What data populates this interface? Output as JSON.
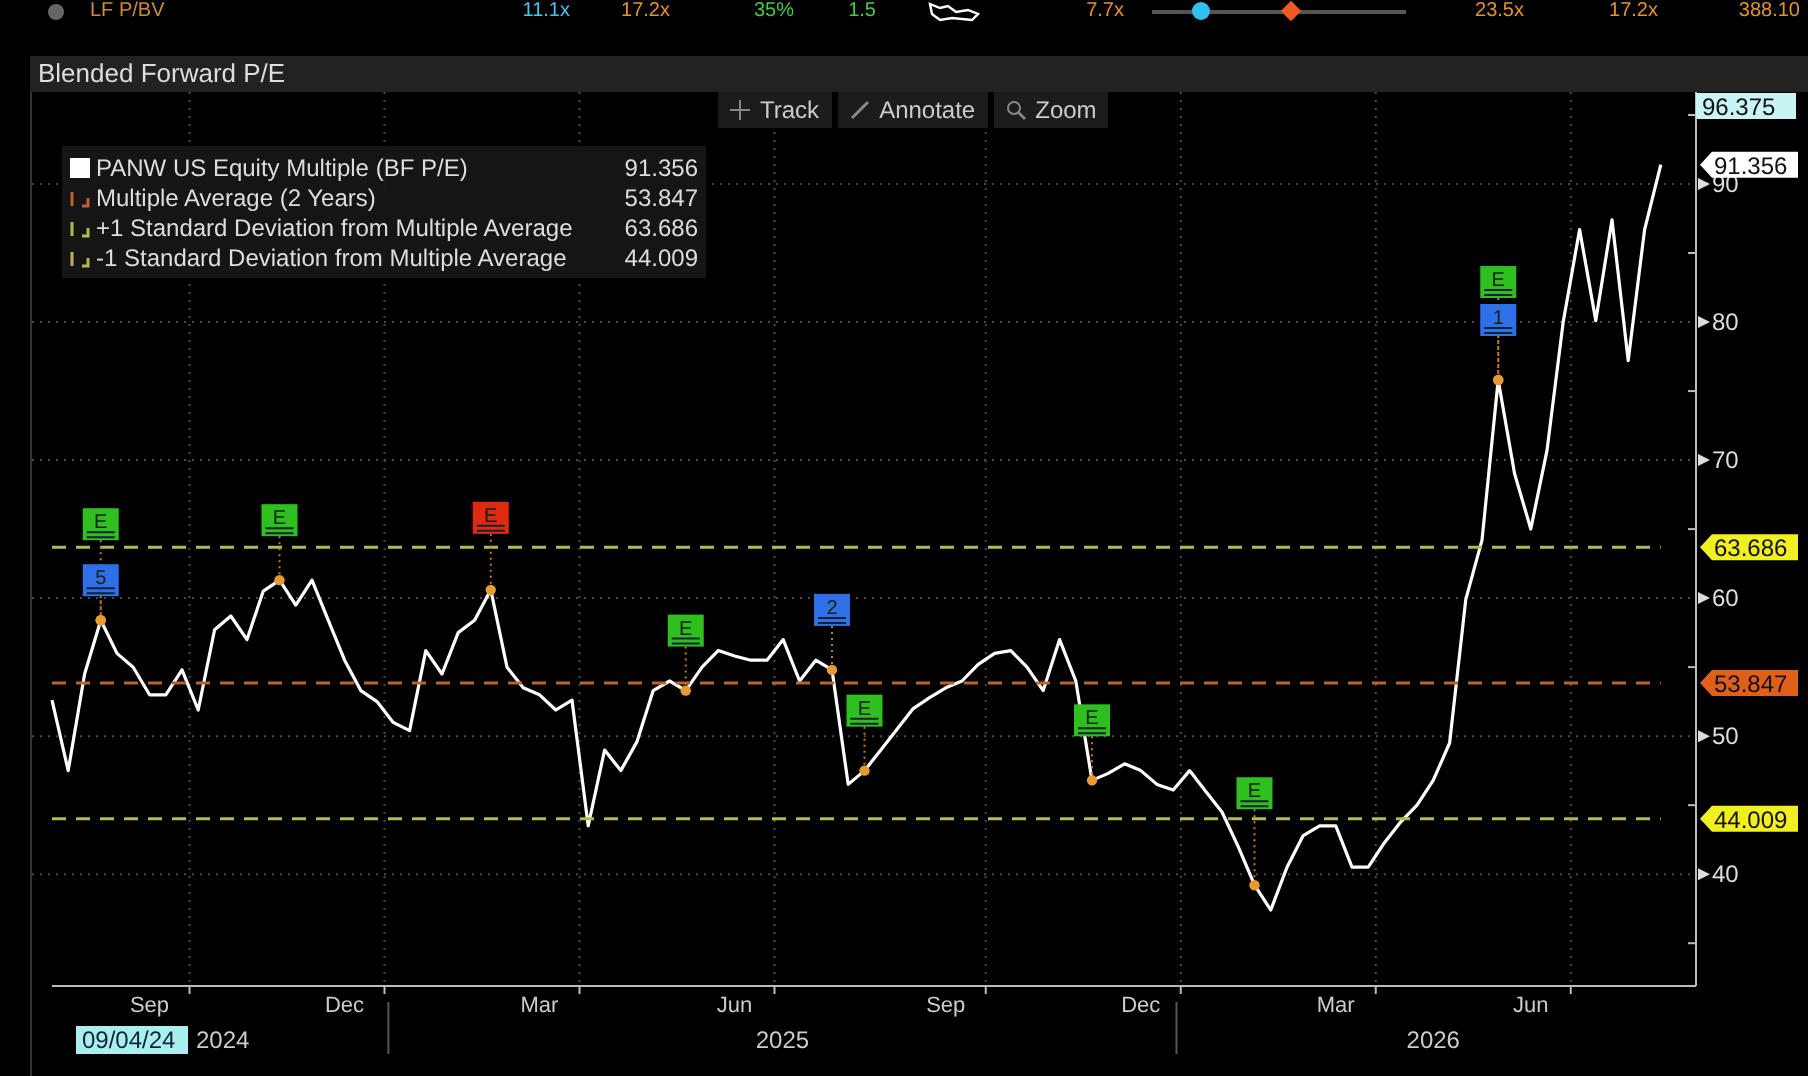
{
  "ticker_strip": {
    "label": {
      "text": "LF P/BV",
      "color": "#d08a30"
    },
    "values": [
      {
        "text": "11.1x",
        "color": "#40c8f0"
      },
      {
        "text": "17.2x",
        "color": "#e8902a"
      },
      {
        "text": "35%",
        "color": "#40d040"
      },
      {
        "text": "1.5",
        "color": "#40d040"
      },
      {
        "text": "7.7x",
        "color": "#e8902a"
      },
      {
        "text": "23.5x",
        "color": "#e8902a"
      },
      {
        "text": "17.2x",
        "color": "#e8902a"
      },
      {
        "text": "388.10",
        "color": "#e8902a"
      }
    ],
    "range_markers": [
      {
        "level": 0.19,
        "color": "#30c0f0"
      },
      {
        "level": 0.54,
        "color": "#f05a20"
      }
    ]
  },
  "panel": {
    "title": "Blended Forward P/E",
    "toolbar": [
      {
        "label": "Track",
        "kind": "crosshair"
      },
      {
        "label": "Annotate",
        "kind": "pencil"
      },
      {
        "label": "Zoom",
        "kind": "search"
      }
    ],
    "legend_values": [
      "91.356",
      "53.847",
      "63.686",
      "44.009"
    ],
    "chart_data": {
      "type": "line",
      "grid": true,
      "legend": "upper left",
      "categories": [
        null,
        null,
        null,
        null,
        null,
        null,
        "Sep",
        null,
        null,
        null,
        null,
        null,
        null,
        null,
        null,
        null,
        null,
        null,
        "Dec",
        null,
        null,
        null,
        null,
        null,
        null,
        null,
        null,
        null,
        null,
        null,
        "Mar",
        null,
        null,
        null,
        null,
        null,
        null,
        null,
        null,
        null,
        null,
        null,
        "Jun",
        null,
        null,
        null,
        null,
        null,
        null,
        null,
        null,
        null,
        null,
        null,
        null,
        "Sep",
        null,
        null,
        null,
        null,
        null,
        null,
        null,
        null,
        null,
        null,
        null,
        "Dec",
        null,
        null,
        null,
        null,
        null,
        null,
        null,
        null,
        null,
        null,
        null,
        "Mar",
        null,
        null,
        null,
        null,
        null,
        null,
        null,
        null,
        null,
        null,
        null,
        "Jun",
        null,
        null,
        null,
        null,
        null,
        null,
        null,
        null
      ],
      "series": [
        {
          "name": "PANW US Equity Multiple (BF P/E)",
          "color": "#ffffff",
          "values": [
            52.6,
            47.5,
            54.5,
            58.4,
            56,
            55,
            53,
            53,
            54.8,
            51.9,
            57.7,
            58.7,
            57,
            60.5,
            61.3,
            59.5,
            61.3,
            58.4,
            55.5,
            53.3,
            52.5,
            51,
            50.4,
            56.2,
            54.5,
            57.5,
            58.4,
            60.6,
            55,
            53.5,
            53,
            51.9,
            52.6,
            43.5,
            49,
            47.5,
            49.6,
            53.3,
            54,
            53.3,
            55,
            56.2,
            55.8,
            55.5,
            55.5,
            57,
            54,
            55.5,
            54.8,
            46.5,
            47.5,
            49,
            50.5,
            52,
            52.8,
            53.5,
            54,
            55.2,
            56,
            56.2,
            55,
            53.3,
            57,
            54,
            46.8,
            47.3,
            48,
            47.5,
            46.5,
            46.1,
            47.5,
            46,
            44.5,
            42,
            39.2,
            37.4,
            40.5,
            42.8,
            43.5,
            43.5,
            40.5,
            40.5,
            42.3,
            43.8,
            45,
            46.8,
            49.5,
            59.9,
            64.2,
            75.8,
            69,
            65,
            70.7,
            80,
            86.7,
            80.1,
            87.4,
            77.2,
            86.7,
            91.4
          ]
        },
        {
          "name": "Multiple Average (2 Years)",
          "color": "#c0602a",
          "line_style": "dashed",
          "values": [
            53.847,
            53.847,
            53.847,
            53.847,
            53.847,
            53.847,
            53.847,
            53.847,
            53.847,
            53.847,
            53.847,
            53.847,
            53.847,
            53.847,
            53.847,
            53.847,
            53.847,
            53.847,
            53.847,
            53.847,
            53.847,
            53.847,
            53.847,
            53.847,
            53.847,
            53.847,
            53.847,
            53.847,
            53.847,
            53.847,
            53.847,
            53.847,
            53.847,
            53.847,
            53.847,
            53.847,
            53.847,
            53.847,
            53.847,
            53.847,
            53.847,
            53.847,
            53.847,
            53.847,
            53.847,
            53.847,
            53.847,
            53.847,
            53.847,
            53.847,
            53.847,
            53.847,
            53.847,
            53.847,
            53.847,
            53.847,
            53.847,
            53.847,
            53.847,
            53.847,
            53.847,
            53.847,
            53.847,
            53.847,
            53.847,
            53.847,
            53.847,
            53.847,
            53.847,
            53.847,
            53.847,
            53.847,
            53.847,
            53.847,
            53.847,
            53.847,
            53.847,
            53.847,
            53.847,
            53.847,
            53.847,
            53.847,
            53.847,
            53.847,
            53.847,
            53.847,
            53.847,
            53.847,
            53.847,
            53.847,
            53.847,
            53.847,
            53.847,
            53.847,
            53.847,
            53.847,
            53.847,
            53.847,
            53.847,
            53.847
          ]
        },
        {
          "name": "+1 Standard Deviation from Multiple Average",
          "color": "#b8b850",
          "line_style": "dashed",
          "values": [
            63.686,
            63.686,
            63.686,
            63.686,
            63.686,
            63.686,
            63.686,
            63.686,
            63.686,
            63.686,
            63.686,
            63.686,
            63.686,
            63.686,
            63.686,
            63.686,
            63.686,
            63.686,
            63.686,
            63.686,
            63.686,
            63.686,
            63.686,
            63.686,
            63.686,
            63.686,
            63.686,
            63.686,
            63.686,
            63.686,
            63.686,
            63.686,
            63.686,
            63.686,
            63.686,
            63.686,
            63.686,
            63.686,
            63.686,
            63.686,
            63.686,
            63.686,
            63.686,
            63.686,
            63.686,
            63.686,
            63.686,
            63.686,
            63.686,
            63.686,
            63.686,
            63.686,
            63.686,
            63.686,
            63.686,
            63.686,
            63.686,
            63.686,
            63.686,
            63.686,
            63.686,
            63.686,
            63.686,
            63.686,
            63.686,
            63.686,
            63.686,
            63.686,
            63.686,
            63.686,
            63.686,
            63.686,
            63.686,
            63.686,
            63.686,
            63.686,
            63.686,
            63.686,
            63.686,
            63.686,
            63.686,
            63.686,
            63.686,
            63.686,
            63.686,
            63.686,
            63.686,
            63.686,
            63.686,
            63.686,
            63.686,
            63.686,
            63.686,
            63.686,
            63.686,
            63.686,
            63.686,
            63.686,
            63.686,
            63.686
          ]
        },
        {
          "name": "-1 Standard Deviation from Multiple Average",
          "color": "#b8b850",
          "line_style": "dashed",
          "values": [
            44.009,
            44.009,
            44.009,
            44.009,
            44.009,
            44.009,
            44.009,
            44.009,
            44.009,
            44.009,
            44.009,
            44.009,
            44.009,
            44.009,
            44.009,
            44.009,
            44.009,
            44.009,
            44.009,
            44.009,
            44.009,
            44.009,
            44.009,
            44.009,
            44.009,
            44.009,
            44.009,
            44.009,
            44.009,
            44.009,
            44.009,
            44.009,
            44.009,
            44.009,
            44.009,
            44.009,
            44.009,
            44.009,
            44.009,
            44.009,
            44.009,
            44.009,
            44.009,
            44.009,
            44.009,
            44.009,
            44.009,
            44.009,
            44.009,
            44.009,
            44.009,
            44.009,
            44.009,
            44.009,
            44.009,
            44.009,
            44.009,
            44.009,
            44.009,
            44.009,
            44.009,
            44.009,
            44.009,
            44.009,
            44.009,
            44.009,
            44.009,
            44.009,
            44.009,
            44.009,
            44.009,
            44.009,
            44.009,
            44.009,
            44.009,
            44.009,
            44.009,
            44.009,
            44.009,
            44.009,
            44.009,
            44.009,
            44.009,
            44.009,
            44.009,
            44.009,
            44.009,
            44.009,
            44.009,
            44.009,
            44.009,
            44.009,
            44.009,
            44.009,
            44.009,
            44.009,
            44.009,
            44.009,
            44.009,
            44.009
          ]
        }
      ],
      "ylim": [
        31.9,
        96.375
      ],
      "yticks": [
        40,
        50,
        60,
        70,
        80,
        90
      ]
    },
    "value_tags": [
      {
        "text": "91.356",
        "color": "#ffffff"
      },
      {
        "text": "63.686",
        "color": "#f0f020"
      },
      {
        "text": "53.847",
        "color": "#e0601a"
      },
      {
        "text": "44.009",
        "color": "#f0f020"
      }
    ],
    "event_flags": [
      {
        "text": "E",
        "color": "#2fbf1f"
      },
      {
        "text": "5",
        "color": "#2f6fe8"
      },
      {
        "text": "E",
        "color": "#2fbf1f"
      },
      {
        "text": "E",
        "color": "#e02a10"
      },
      {
        "text": "E",
        "color": "#2fbf1f"
      },
      {
        "text": "2",
        "color": "#2f6fe8"
      },
      {
        "text": "E",
        "color": "#2fbf1f"
      },
      {
        "text": "E",
        "color": "#2fbf1f"
      },
      {
        "text": "E",
        "color": "#2fbf1f"
      },
      {
        "text": "E",
        "color": "#2fbf1f"
      },
      {
        "text": "1",
        "color": "#2f6fe8"
      }
    ],
    "axis_max_tag": "96.375",
    "x_axis": {
      "start_date": "09/04/24",
      "years": [
        "2024",
        "2025",
        "2026"
      ]
    }
  }
}
